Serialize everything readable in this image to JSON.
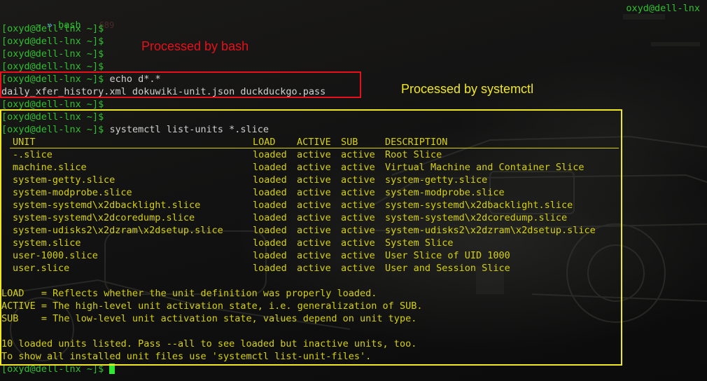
{
  "titlebar": {
    "tilde": "~",
    "chevron": "»",
    "tab_name": "bash",
    "tab_pid": "689",
    "host": "oxyd@dell-lnx"
  },
  "prompt": "[oxyd@dell-lnx ~]$",
  "annotations": {
    "bash_label": "Processed by bash",
    "systemctl_label": "Processed by systemctl",
    "bash_color": "#e8101a",
    "systemctl_color": "#f0e823"
  },
  "commands": {
    "echo_cmd": "echo d*.*",
    "echo_output": "daily_xfer_history.xml dokuwiki-unit.json duckduckgo.pass",
    "systemctl_cmd": "systemctl list-units *.slice"
  },
  "units_table": {
    "headers": [
      "UNIT",
      "LOAD",
      "ACTIVE",
      "SUB",
      "DESCRIPTION"
    ],
    "rows": [
      [
        "-.slice",
        "loaded",
        "active",
        "active",
        "Root Slice"
      ],
      [
        "machine.slice",
        "loaded",
        "active",
        "active",
        "Virtual Machine and Container Slice"
      ],
      [
        "system-getty.slice",
        "loaded",
        "active",
        "active",
        "system-getty.slice"
      ],
      [
        "system-modprobe.slice",
        "loaded",
        "active",
        "active",
        "system-modprobe.slice"
      ],
      [
        "system-systemd\\x2dbacklight.slice",
        "loaded",
        "active",
        "active",
        "system-systemd\\x2dbacklight.slice"
      ],
      [
        "system-systemd\\x2dcoredump.slice",
        "loaded",
        "active",
        "active",
        "system-systemd\\x2dcoredump.slice"
      ],
      [
        "system-udisks2\\x2dzram\\x2dsetup.slice",
        "loaded",
        "active",
        "active",
        "system-udisks2\\x2dzram\\x2dsetup.slice"
      ],
      [
        "system.slice",
        "loaded",
        "active",
        "active",
        "System Slice"
      ],
      [
        "user-1000.slice",
        "loaded",
        "active",
        "active",
        "User Slice of UID 1000"
      ],
      [
        "user.slice",
        "loaded",
        "active",
        "active",
        "User and Session Slice"
      ]
    ]
  },
  "legend": {
    "load": "LOAD   = Reflects whether the unit definition was properly loaded.",
    "active": "ACTIVE = The high-level unit activation state, i.e. generalization of SUB.",
    "sub": "SUB    = The low-level unit activation state, values depend on unit type."
  },
  "summary": {
    "line1": "10 loaded units listed. Pass --all to see loaded but inactive units, too.",
    "line2": "To show all installed unit files use 'systemctl list-unit-files'."
  },
  "colors": {
    "prompt_green": "#2fc02f",
    "output_yellow": "#d6d20a",
    "cursor_green": "#2fe82f"
  }
}
